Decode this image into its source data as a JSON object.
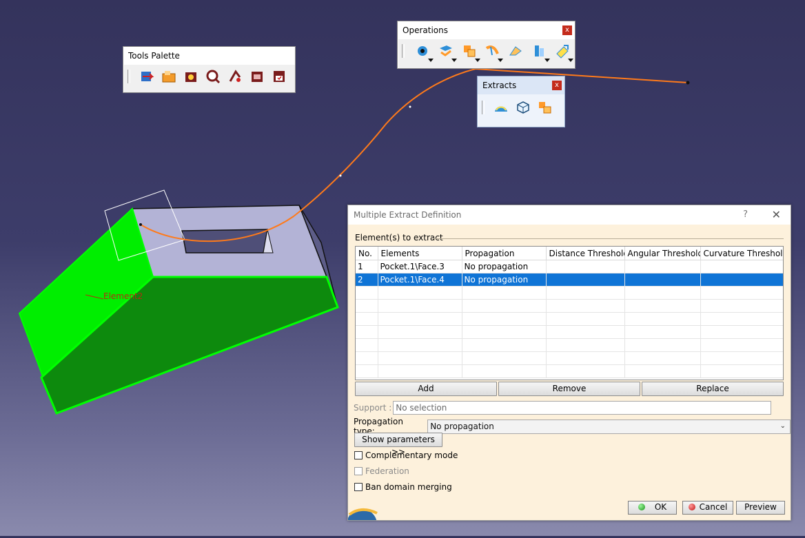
{
  "viewport": {
    "annotation": "Element2",
    "colors": {
      "face_top": "#b3b3d6",
      "face_side": "#0d8a0d",
      "face_bright": "#00ee00",
      "curve": "#ff7a1a"
    }
  },
  "tools_palette": {
    "title": "Tools Palette",
    "icons": [
      "axis-system-icon",
      "folder-icon",
      "catalog-icon",
      "measure-icon",
      "inertia-icon",
      "publish-icon",
      "save-icon"
    ]
  },
  "operations": {
    "title": "Operations",
    "close": "x",
    "icons": [
      "join-icon",
      "untrim-icon",
      "extract-icon",
      "split-icon",
      "trim-icon",
      "boundary-icon",
      "translate-icon"
    ]
  },
  "extracts": {
    "title": "Extracts",
    "close": "x",
    "icons": [
      "boundary-extract-icon",
      "extract-icon",
      "multiple-extract-icon"
    ]
  },
  "dialog": {
    "title": "Multiple Extract Definition",
    "help": "?",
    "close": "✕",
    "group_label": "Element(s) to extract",
    "columns": [
      "No.",
      "Elements",
      "Propagation",
      "Distance Threshold",
      "Angular Threshold",
      "Curvature Threshold"
    ],
    "rows": [
      {
        "no": "1",
        "element": "Pocket.1\\Face.3",
        "propagation": "No propagation",
        "distance": "",
        "angular": "",
        "curvature": ""
      },
      {
        "no": "2",
        "element": "Pocket.1\\Face.4",
        "propagation": "No propagation",
        "distance": "",
        "angular": "",
        "curvature": ""
      }
    ],
    "selected_row": 2,
    "buttons": {
      "add": "Add",
      "remove": "Remove",
      "replace": "Replace"
    },
    "support_label": "Support :",
    "support_value": "No selection",
    "propagation_label": "Propagation type:",
    "propagation_value": "No propagation",
    "show_parameters": "Show parameters >>",
    "checkboxes": {
      "complementary": "Complementary mode",
      "federation": "Federation",
      "ban_merging": "Ban domain merging"
    },
    "ok": "OK",
    "cancel": "Cancel",
    "preview": "Preview"
  }
}
